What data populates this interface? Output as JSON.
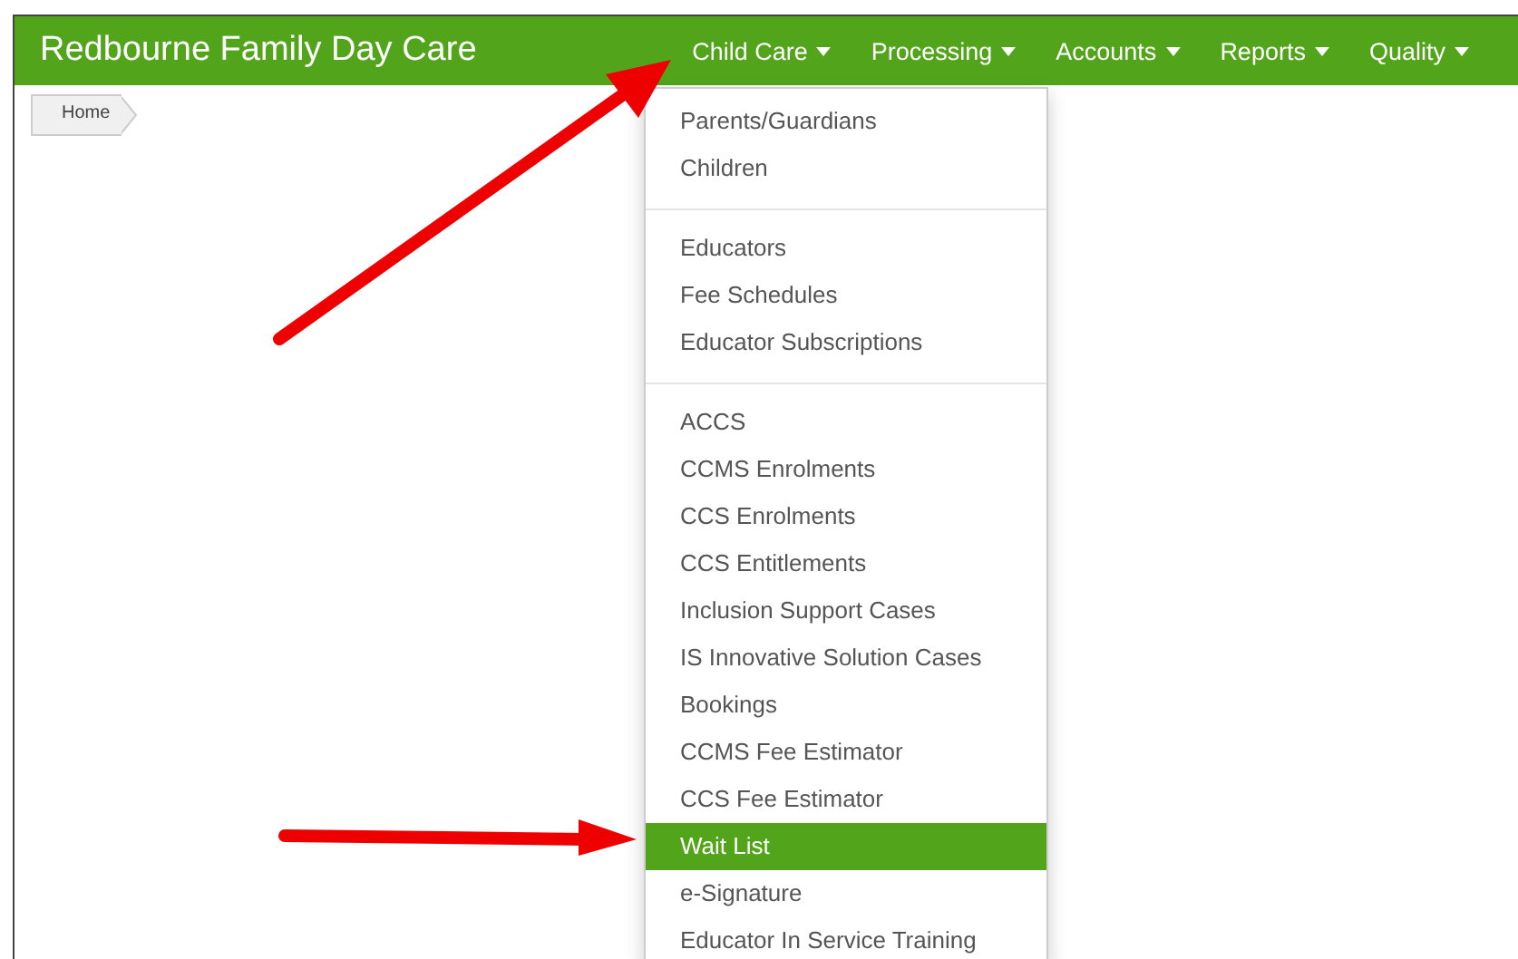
{
  "brand": "Redbourne Family Day Care",
  "nav": [
    "Child Care",
    "Processing",
    "Accounts",
    "Reports",
    "Quality"
  ],
  "breadcrumb": [
    "Home"
  ],
  "menu_sections": [
    [
      {
        "label": "Parents/Guardians",
        "selected": false
      },
      {
        "label": "Children",
        "selected": false
      }
    ],
    [
      {
        "label": "Educators",
        "selected": false
      },
      {
        "label": "Fee Schedules",
        "selected": false
      },
      {
        "label": "Educator Subscriptions",
        "selected": false
      }
    ],
    [
      {
        "label": "ACCS",
        "selected": false
      },
      {
        "label": "CCMS Enrolments",
        "selected": false
      },
      {
        "label": "CCS Enrolments",
        "selected": false
      },
      {
        "label": "CCS Entitlements",
        "selected": false
      },
      {
        "label": "Inclusion Support Cases",
        "selected": false
      },
      {
        "label": "IS Innovative Solution Cases",
        "selected": false
      },
      {
        "label": "Bookings",
        "selected": false
      },
      {
        "label": "CCMS Fee Estimator",
        "selected": false
      },
      {
        "label": "CCS Fee Estimator",
        "selected": false
      },
      {
        "label": "Wait List",
        "selected": true
      },
      {
        "label": "e-Signature",
        "selected": false
      },
      {
        "label": "Educator In Service Training",
        "selected": false
      }
    ]
  ]
}
